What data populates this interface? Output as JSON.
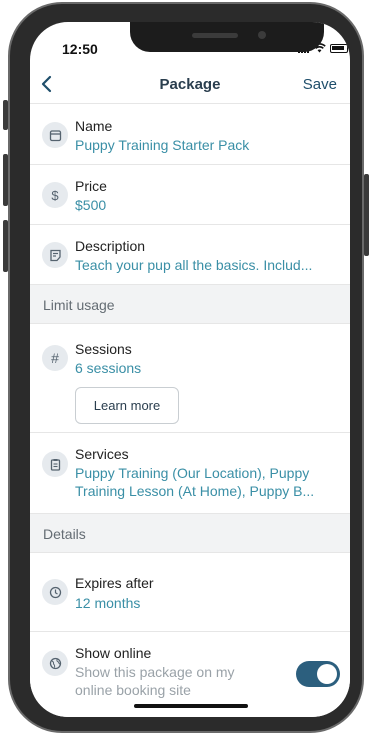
{
  "status_bar": {
    "time": "12:50"
  },
  "nav": {
    "title": "Package",
    "save_label": "Save",
    "back_icon": "chevron-left-icon"
  },
  "fields": {
    "name": {
      "label": "Name",
      "value": "Puppy Training Starter Pack",
      "icon": "package-icon"
    },
    "price": {
      "label": "Price",
      "value": "$500",
      "icon": "dollar-icon"
    },
    "description": {
      "label": "Description",
      "value": "Teach your pup all the basics. Includ...",
      "icon": "note-icon"
    }
  },
  "sections": {
    "limit_usage": "Limit usage",
    "details": "Details"
  },
  "sessions": {
    "label": "Sessions",
    "value": "6 sessions",
    "icon": "hash-icon",
    "learn_more": "Learn more"
  },
  "services": {
    "label": "Services",
    "value_line1": "Puppy Training (Our Location), Puppy",
    "value_line2": "Training Lesson (At Home), Puppy B...",
    "icon": "clipboard-icon"
  },
  "expires": {
    "label": "Expires after",
    "value": "12 months",
    "icon": "clock-icon"
  },
  "show_online": {
    "label": "Show online",
    "sub_line1": "Show this package on my",
    "sub_line2": "online booking site",
    "icon": "globe-icon",
    "enabled": true
  },
  "colors": {
    "accent": "#3a8fa6",
    "nav": "#1f4e6b",
    "toggle": "#2c5f7e"
  }
}
